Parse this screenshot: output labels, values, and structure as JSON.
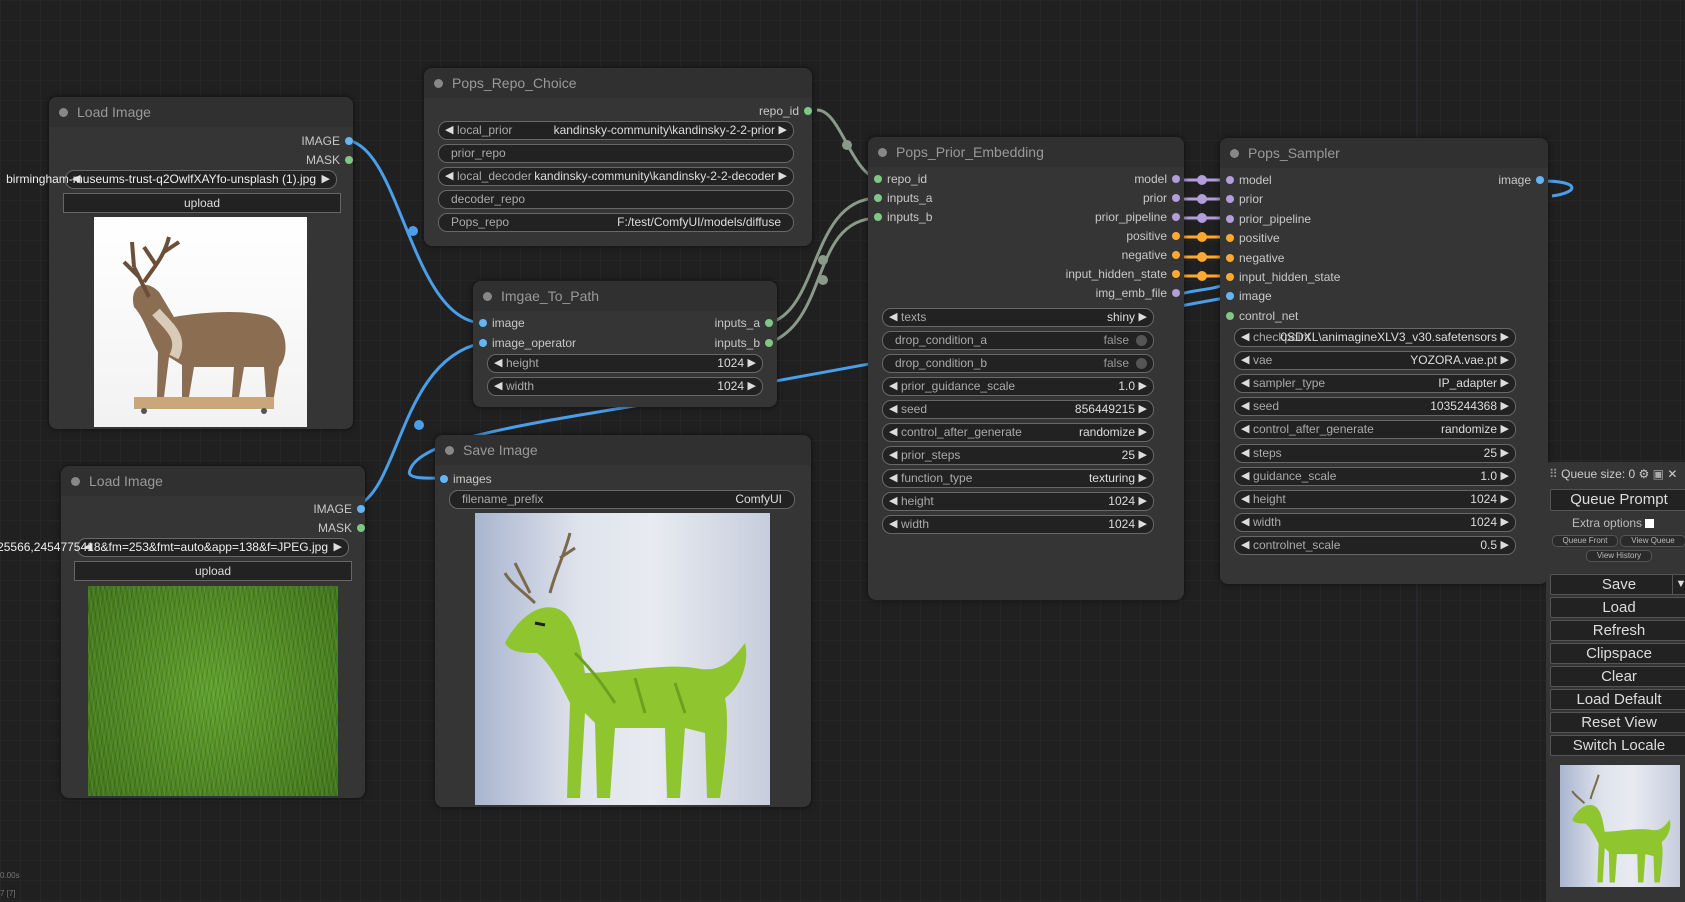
{
  "colors": {
    "image": "#64b5f6",
    "mask": "#81c784",
    "model": "#b39ddb",
    "conditioning": "#ffa931",
    "link_blue": "#4a9eea",
    "link_gray": "#8a9a8a"
  },
  "nodes": {
    "load_image_1": {
      "title": "Load Image",
      "out_image": "IMAGE",
      "out_mask": "MASK",
      "image_file": "birmingham-museums-trust-q2OwlfXAYfo-unsplash (1).jpg",
      "upload": "upload"
    },
    "load_image_2": {
      "title": "Load Image",
      "out_image": "IMAGE",
      "out_mask": "MASK",
      "image_file": "25566,2454775418&fm=253&fmt=auto&app=138&f=JPEG.jpg",
      "upload": "upload"
    },
    "repo_choice": {
      "title": "Pops_Repo_Choice",
      "out_repo_id": "repo_id",
      "local_prior_label": "local_prior",
      "local_prior_value": "kandinsky-community\\kandinsky-2-2-prior",
      "prior_repo": "prior_repo",
      "local_decoder_label": "local_decoder",
      "local_decoder_value": "kandinsky-community\\kandinsky-2-2-decoder",
      "decoder_repo": "decoder_repo",
      "pops_repo_label": "Pops_repo",
      "pops_repo_value": "F:/test/ComfyUI/models/diffuse"
    },
    "img_to_path": {
      "title": "Imgae_To_Path",
      "in_image": "image",
      "in_image_operator": "image_operator",
      "out_inputs_a": "inputs_a",
      "out_inputs_b": "inputs_b",
      "height_label": "height",
      "height_value": "1024",
      "width_label": "width",
      "width_value": "1024"
    },
    "save_image": {
      "title": "Save Image",
      "in_images": "images",
      "filename_prefix_label": "filename_prefix",
      "filename_prefix_value": "ComfyUI"
    },
    "prior_embedding": {
      "title": "Pops_Prior_Embedding",
      "inputs": [
        "repo_id",
        "inputs_a",
        "inputs_b"
      ],
      "outputs": [
        "model",
        "prior",
        "prior_pipeline",
        "positive",
        "negative",
        "input_hidden_state",
        "img_emb_file"
      ],
      "widgets": [
        {
          "label": "texts",
          "value": "shiny"
        },
        {
          "label": "drop_condition_a",
          "value": "false"
        },
        {
          "label": "drop_condition_b",
          "value": "false"
        },
        {
          "label": "prior_guidance_scale",
          "value": "1.0"
        },
        {
          "label": "seed",
          "value": "856449215"
        },
        {
          "label": "control_after_generate",
          "value": "randomize"
        },
        {
          "label": "prior_steps",
          "value": "25"
        },
        {
          "label": "function_type",
          "value": "texturing"
        },
        {
          "label": "height",
          "value": "1024"
        },
        {
          "label": "width",
          "value": "1024"
        }
      ]
    },
    "sampler": {
      "title": "Pops_Sampler",
      "inputs": [
        "model",
        "prior",
        "prior_pipeline",
        "positive",
        "negative",
        "input_hidden_state",
        "image",
        "control_net"
      ],
      "out_image": "image",
      "widgets": [
        {
          "label": "checkpoint",
          "value": "0SDXL\\animagineXLV3_v30.safetensors"
        },
        {
          "label": "vae",
          "value": "YOZORA.vae.pt"
        },
        {
          "label": "sampler_type",
          "value": "IP_adapter"
        },
        {
          "label": "seed",
          "value": "1035244368"
        },
        {
          "label": "control_after_generate",
          "value": "randomize"
        },
        {
          "label": "steps",
          "value": "25"
        },
        {
          "label": "guidance_scale",
          "value": "1.0"
        },
        {
          "label": "height",
          "value": "1024"
        },
        {
          "label": "width",
          "value": "1024"
        },
        {
          "label": "controlnet_scale",
          "value": "0.5"
        }
      ]
    }
  },
  "queue": {
    "size_label": "Queue size: 0",
    "queue_prompt": "Queue Prompt",
    "extra_options": "Extra options",
    "queue_front": "Queue Front",
    "view_queue": "View Queue",
    "view_history": "View History",
    "save": "Save",
    "load": "Load",
    "refresh": "Refresh",
    "clipspace": "Clipspace",
    "clear": "Clear",
    "load_default": "Load Default",
    "reset_view": "Reset View",
    "switch_locale": "Switch Locale"
  },
  "corner_stats": {
    "line1": "0.00s",
    "line2": "7 [7]"
  }
}
